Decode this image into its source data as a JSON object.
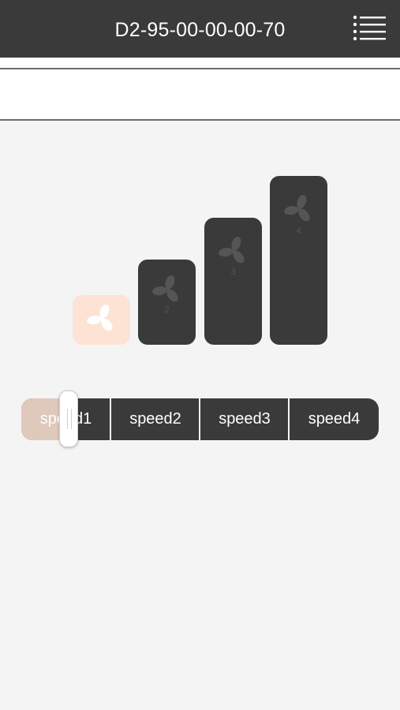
{
  "header": {
    "title": "D2-95-00-00-00-70",
    "menu_icon": "hamburger-list-icon"
  },
  "fan_levels": [
    {
      "label": "1",
      "icon": "fan-icon",
      "active": true
    },
    {
      "label": "2",
      "icon": "fan-icon",
      "active": false
    },
    {
      "label": "3",
      "icon": "fan-icon",
      "active": false
    },
    {
      "label": "4",
      "icon": "fan-icon",
      "active": false
    }
  ],
  "speed_selector": {
    "segments": [
      "speed1",
      "speed2",
      "speed3",
      "speed4"
    ],
    "selected": "speed1",
    "level": 1
  },
  "colors": {
    "header_bg": "#3a3a3a",
    "inactive_block": "#3a3a3a",
    "active_block": "#fde3d3",
    "background": "#f4f4f4"
  }
}
